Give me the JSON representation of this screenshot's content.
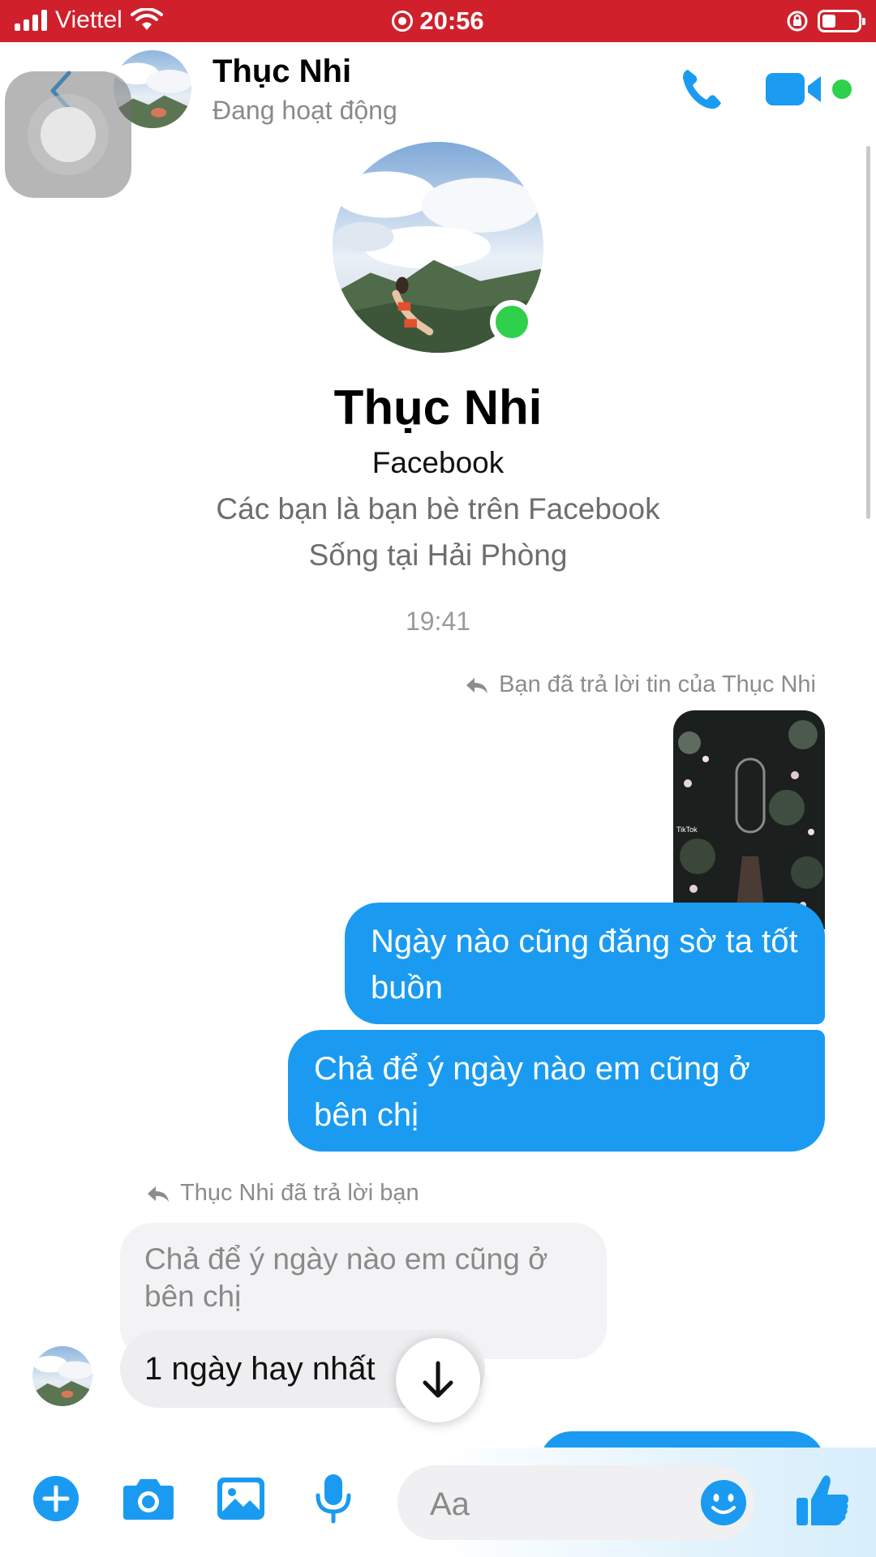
{
  "status_bar": {
    "carrier": "Viettel",
    "time": "20:56"
  },
  "header": {
    "name": "Thục Nhi",
    "status": "Đang hoạt động"
  },
  "profile": {
    "name": "Thục Nhi",
    "source": "Facebook",
    "relationship": "Các bạn là bạn bè trên Facebook",
    "lives_in": "Sống tại Hải Phòng"
  },
  "conversation": {
    "timestamp": "19:41",
    "reply_note_outgoing": "Bạn đã trả lời tin của Thục Nhi",
    "media_label": "TikTok",
    "messages_out": [
      "Ngày nào cũng đăng sờ ta tốt buồn",
      "Chả để ý ngày nào em cũng ở bên chị"
    ],
    "reply_note_incoming": "Thục Nhi đã trả lời bạn",
    "quoted_message": "Chả để ý ngày nào em cũng ở bên chị",
    "message_in": "1 ngày hay nhất"
  },
  "composer": {
    "placeholder": "Aa"
  },
  "colors": {
    "accent": "#1a9bf1",
    "status_bar": "#cf202c",
    "online": "#2fd04c"
  },
  "icons": [
    "back-icon",
    "phone-icon",
    "video-icon",
    "plus-icon",
    "camera-icon",
    "image-icon",
    "mic-icon",
    "emoji-icon",
    "like-icon",
    "reply-icon",
    "arrow-down-icon"
  ]
}
